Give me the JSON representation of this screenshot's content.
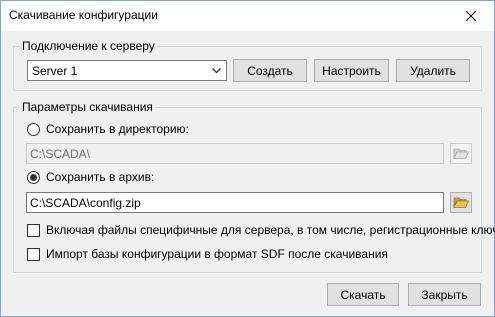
{
  "window": {
    "title": "Скачивание конфигурации"
  },
  "connection": {
    "legend": "Подключение к серверу",
    "server_selected": "Server 1",
    "create_label": "Создать",
    "configure_label": "Настроить",
    "delete_label": "Удалить"
  },
  "download": {
    "legend": "Параметры скачивания",
    "save_to_dir_label": "Сохранить в директорию:",
    "save_to_dir_checked": false,
    "dir_path": "C:\\SCADA\\",
    "save_to_archive_label": "Сохранить в архив:",
    "save_to_archive_checked": true,
    "archive_path": "C:\\SCADA\\config.zip",
    "include_server_files_label": "Включая файлы специфичные для сервера, в том числе, регистрационные ключи",
    "include_server_files_checked": false,
    "import_sdf_label": "Импорт базы конфигурации в формат SDF после скачивания",
    "import_sdf_checked": false
  },
  "footer": {
    "download_label": "Скачать",
    "close_label": "Закрыть"
  },
  "icons": {
    "close": "close-icon",
    "combo_arrow": "chevron-down-icon",
    "folder": "folder-open-icon"
  },
  "colors": {
    "folder_yellow": "#e8c25a",
    "folder_disabled": "#c8c8c8",
    "button_face": "#e1e1e1",
    "button_border": "#adadad"
  }
}
